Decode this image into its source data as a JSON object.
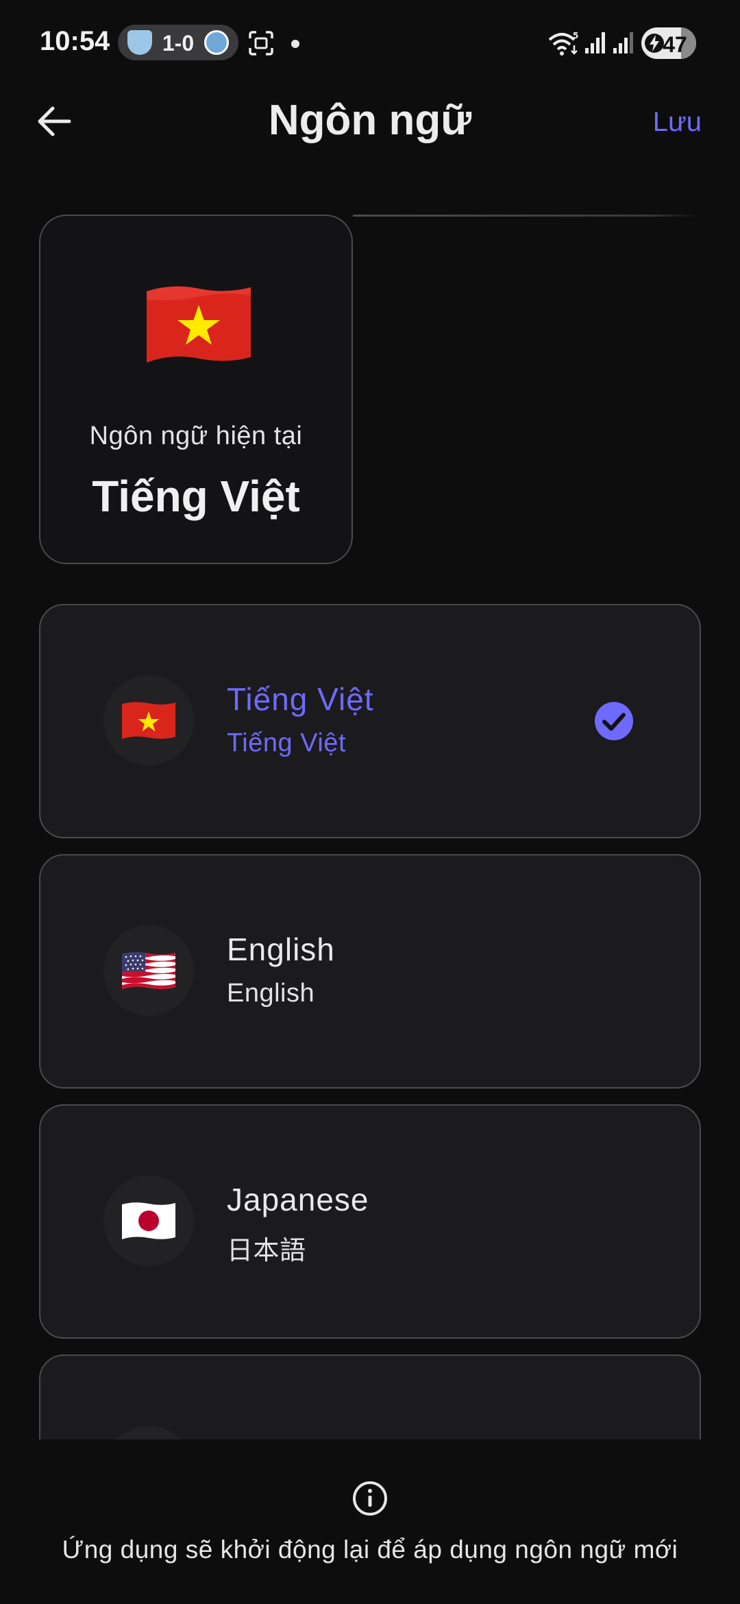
{
  "status_bar": {
    "time": "10:54",
    "score": "1-0",
    "battery": "47"
  },
  "header": {
    "title": "Ngôn ngữ",
    "save_label": "Lưu",
    "back_icon": "arrow-left-icon"
  },
  "current_language": {
    "label": "Ngôn ngữ hiện tại",
    "value": "Tiếng Việt",
    "flag": "vietnam-flag"
  },
  "languages": [
    {
      "name": "Tiếng Việt",
      "native": "Tiếng Việt",
      "flag": "vietnam-flag",
      "selected": true
    },
    {
      "name": "English",
      "native": "English",
      "flag": "usa-flag",
      "selected": false
    },
    {
      "name": "Japanese",
      "native": "日本語",
      "flag": "japan-flag",
      "selected": false
    }
  ],
  "footer": {
    "note": "Ứng dụng sẽ khởi động lại để áp dụng ngôn ngữ mới",
    "icon": "info-icon"
  },
  "colors": {
    "accent": "#6f6aff",
    "background": "#0d0d0e",
    "card": "#1b1b1d",
    "border": "#4a4a4d"
  }
}
